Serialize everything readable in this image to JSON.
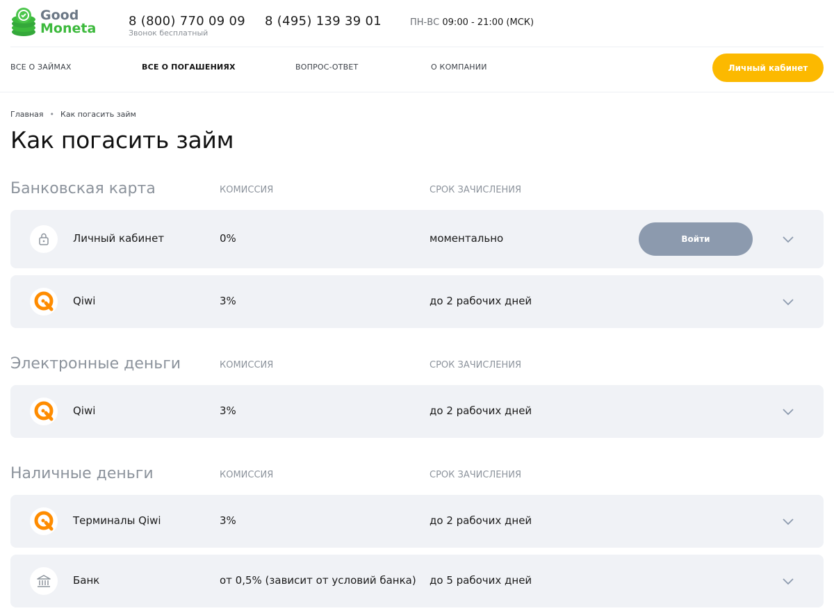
{
  "brand": {
    "line1": "Good",
    "line2": "Moneta",
    "accent": "#3cb93c"
  },
  "header": {
    "phone1": "8 (800) 770 09 09",
    "phone1_note": "Звонок бесплатный",
    "phone2": "8 (495) 139 39 01",
    "hours_days": "ПН-ВС",
    "hours_time": "09:00 - 21:00 (МСК)"
  },
  "nav": {
    "items": [
      {
        "label": "ВСЕ О ЗАЙМАХ"
      },
      {
        "label": "ВСЕ О ПОГАШЕНИЯХ"
      },
      {
        "label": "ВОПРОС-ОТВЕТ"
      },
      {
        "label": "О КОМПАНИИ"
      }
    ],
    "cabinet_label": "Личный кабинет",
    "cabinet_color": "#fcb900"
  },
  "breadcrumb": {
    "home": "Главная",
    "current": "Как погасить займ"
  },
  "page_title": "Как погасить займ",
  "columns": {
    "fee": "КОМИССИЯ",
    "term": "СРОК ЗАЧИСЛЕНИЯ"
  },
  "sections": [
    {
      "title": "Банковская карта",
      "rows": [
        {
          "icon": "lock-icon",
          "name": "Личный кабинет",
          "fee": "0%",
          "term": "моментально",
          "action": "Войти"
        },
        {
          "icon": "qiwi-icon",
          "name": "Qiwi",
          "fee": "3%",
          "term": "до 2 рабочих дней"
        }
      ]
    },
    {
      "title": "Электронные деньги",
      "rows": [
        {
          "icon": "qiwi-icon",
          "name": "Qiwi",
          "fee": "3%",
          "term": "до 2 рабочих дней"
        }
      ]
    },
    {
      "title": "Наличные деньги",
      "rows": [
        {
          "icon": "qiwi-icon",
          "name": "Терминалы Qiwi",
          "fee": "3%",
          "term": "до 2 рабочих дней"
        },
        {
          "icon": "bank-icon",
          "name": "Банк",
          "fee": "от 0,5% (зависит от условий банка)",
          "term": "до 5 рабочих дней"
        }
      ]
    }
  ]
}
